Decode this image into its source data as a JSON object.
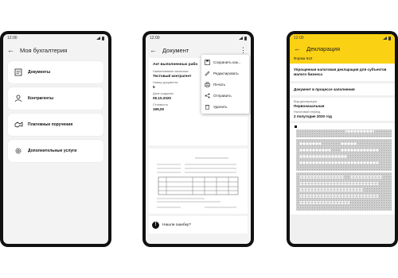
{
  "phone1": {
    "status_time": "12:00",
    "title": "Моя бухгалтерия",
    "items": [
      {
        "label": "Документы",
        "icon": "documents-icon"
      },
      {
        "label": "Контрагенты",
        "icon": "person-icon"
      },
      {
        "label": "Платежные поручения",
        "icon": "handshake-icon"
      },
      {
        "label": "Дополнительные услуги",
        "icon": "gear-icon"
      }
    ]
  },
  "phone2": {
    "status_time": "12:00",
    "title": "Документ",
    "doc_title": "Акт выполненных рабо",
    "customer_label": "Наименование заказчика",
    "customer_value": "Тестовый контрагент",
    "number_label": "Номер документа",
    "number_value": "5",
    "date_label": "Дата создания",
    "date_value": "05.10.2020",
    "cost_label": "Стоимость",
    "cost_value": "199,00",
    "menu": [
      {
        "label": "Сохранить как...",
        "icon": "save-icon"
      },
      {
        "label": "Редактировать",
        "icon": "edit-icon"
      },
      {
        "label": "Печать",
        "icon": "print-icon"
      },
      {
        "label": "Отправить",
        "icon": "share-icon"
      },
      {
        "label": "Удалить",
        "icon": "trash-icon"
      }
    ],
    "error_label": "Нашли ошибку?"
  },
  "phone3": {
    "status_time": "12:00",
    "title": "Декларация",
    "form_label": "Форма 910",
    "decl_title": "Упрощенная налоговая декларация для субъектов малого бизнеса",
    "status_text": "Документ в процессе заполнения",
    "type_label": "Вид декларации",
    "type_value": "Первоначальная",
    "period_label": "Налоговый период",
    "period_value": "2 полугодие 2020 год"
  },
  "colors": {
    "accent": "#fbd114",
    "frame": "#111111",
    "background": "#f3f3f3"
  }
}
